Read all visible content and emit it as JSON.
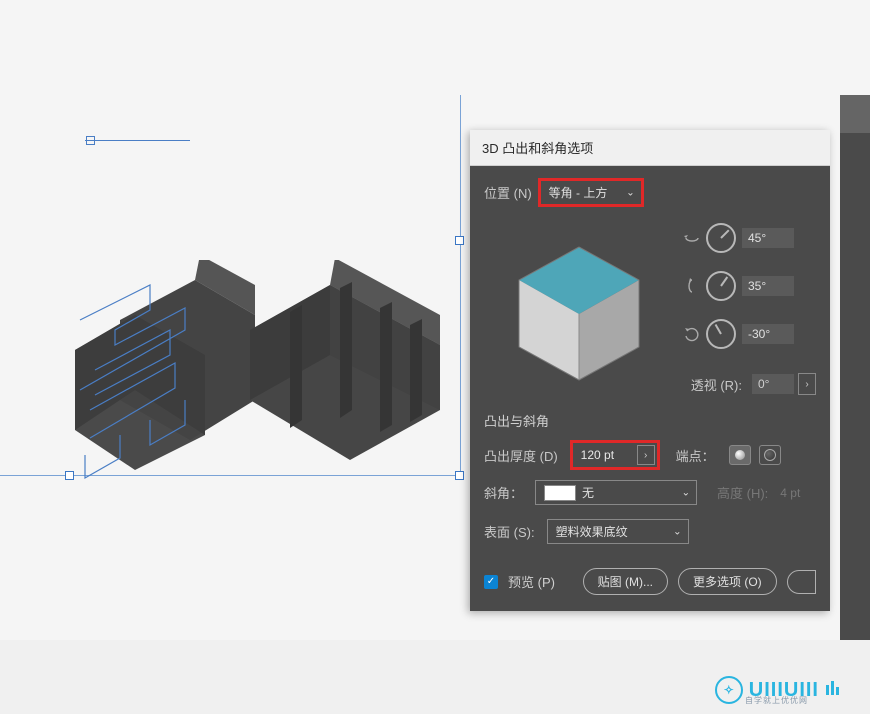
{
  "dialog": {
    "title": "3D 凸出和斜角选项",
    "position_label": "位置 (N)",
    "position_value": "等角 - 上方",
    "rotation": {
      "x": "45°",
      "y": "35°",
      "z": "-30°"
    },
    "perspective_label": "透视 (R):",
    "perspective_value": "0°",
    "section_bevel": "凸出与斜角",
    "extrude_label": "凸出厚度 (D)",
    "extrude_value": "120 pt",
    "cap_label": "端点：",
    "bevel_label": "斜角：",
    "bevel_value": "无",
    "height_label": "高度 (H):",
    "height_value": "4 pt",
    "surface_label": "表面 (S):",
    "surface_value": "塑料效果底纹",
    "preview_label": "预览 (P)",
    "map_art_btn": "贴图 (M)...",
    "more_options_btn": "更多选项 (O)"
  },
  "watermark": {
    "text": "UIIIUIII",
    "sub": "自学就上优优网"
  },
  "chart_data": {
    "type": "panel-settings",
    "position_preset": "等角 - 上方",
    "rotation_x_deg": 45,
    "rotation_y_deg": 35,
    "rotation_z_deg": -30,
    "perspective_deg": 0,
    "extrude_depth_pt": 120,
    "bevel": "无",
    "bevel_height_pt": 4,
    "surface": "塑料效果底纹",
    "preview_checked": true,
    "cap": "on"
  }
}
